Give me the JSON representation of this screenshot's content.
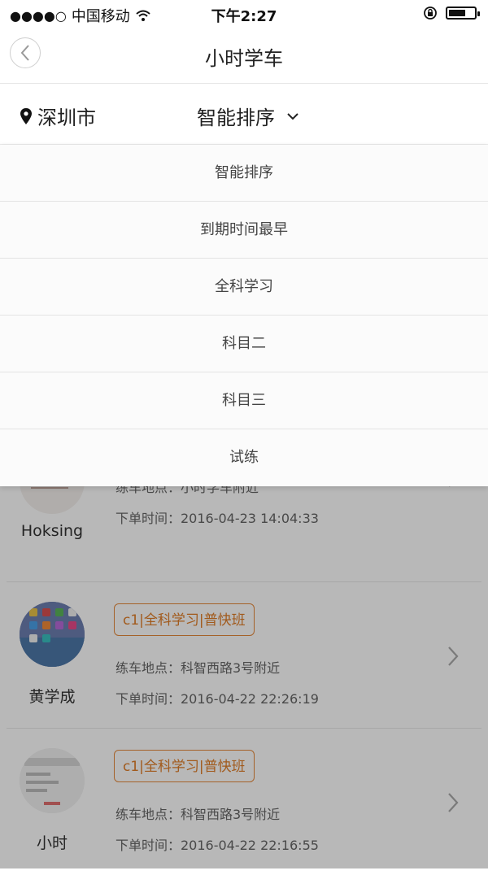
{
  "status_bar": {
    "signal_dots": "●●●●○",
    "carrier": "中国移动",
    "time": "下午2:27",
    "battery_level": 0.7
  },
  "nav": {
    "title": "小时学车"
  },
  "filter": {
    "city": "深圳市",
    "sort_label": "智能排序"
  },
  "dropdown": {
    "items": [
      {
        "label": "智能排序"
      },
      {
        "label": "到期时间最早"
      },
      {
        "label": "全科学习"
      },
      {
        "label": "科目二"
      },
      {
        "label": "科目三"
      },
      {
        "label": "试练"
      }
    ]
  },
  "orders": [
    {
      "name": "Hoksing",
      "place": "练车地点：小时学车附近",
      "order_time": "下单时间：2016-04-23 14:04:33"
    },
    {
      "name": "黄学成",
      "tag": "c1|全科学习|普快班",
      "place": "练车地点：科智西路3号附近",
      "order_time": "下单时间：2016-04-22 22:26:19"
    },
    {
      "name": "小时",
      "tag": "c1|全科学习|普快班",
      "place": "练车地点：科智西路3号附近",
      "order_time": "下单时间：2016-04-22 22:16:55"
    }
  ],
  "colors": {
    "accent": "#e07d28",
    "overlay": "rgba(0,0,0,0.28)"
  }
}
